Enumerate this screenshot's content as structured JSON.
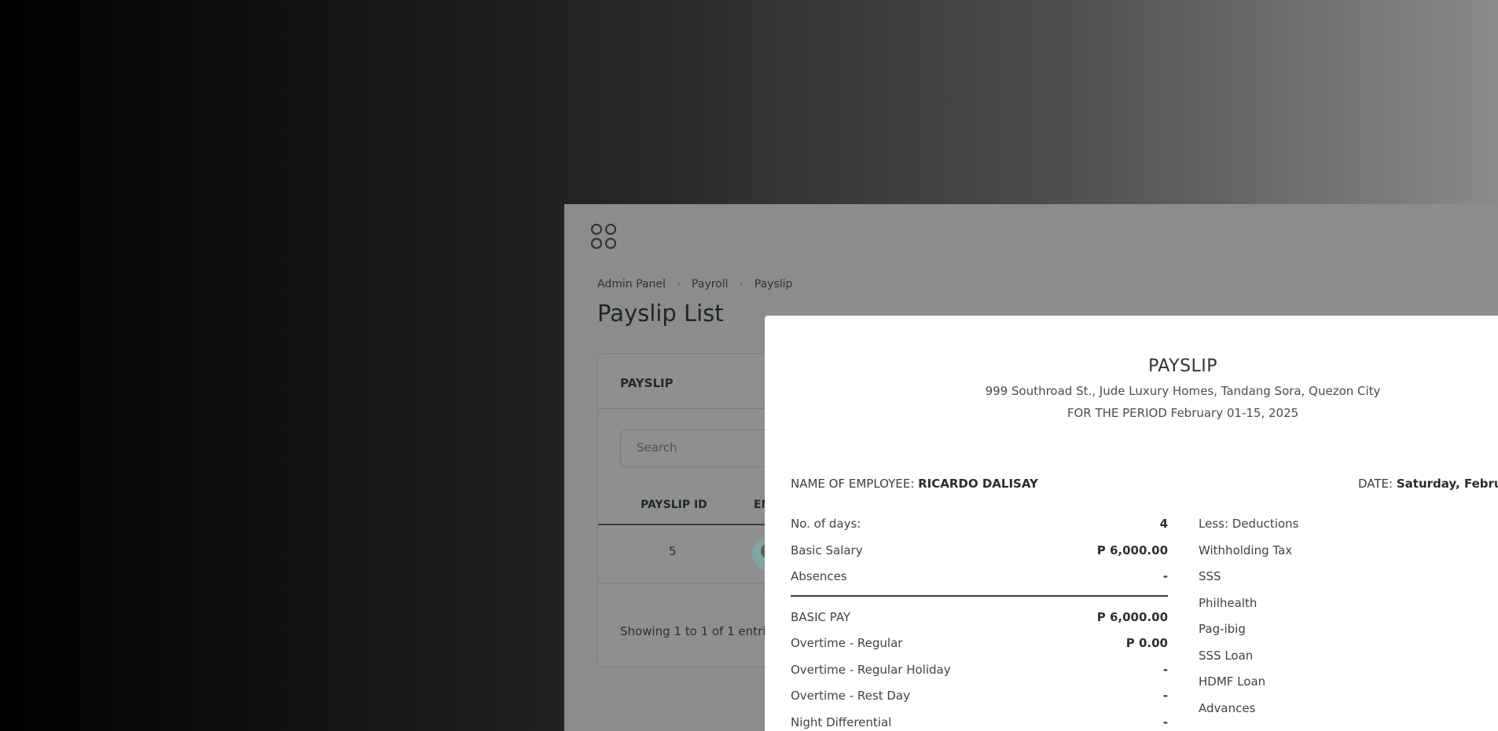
{
  "breadcrumb": [
    "Admin Panel",
    "Payroll",
    "Payslip"
  ],
  "breadcrumb_separator": "›",
  "page_title": "Payslip List",
  "card": {
    "header": "PAYSLIP",
    "search_placeholder": "Search",
    "columns": [
      "PAYSLIP ID",
      "EM"
    ],
    "rows": [
      {
        "id": "5"
      }
    ],
    "showing": "Showing 1 to 1 of 1 entrie"
  },
  "payslip": {
    "title": "PAYSLIP",
    "address": "999 Southroad St., Jude Luxury Homes, Tandang Sora, Quezon City",
    "period": "FOR THE PERIOD February 01-15, 2025",
    "name_label": "NAME OF EMPLOYEE:",
    "name_value": "RICARDO DALISAY",
    "date_label": "DATE:",
    "date_value": "Saturday, Febru",
    "earnings_top": [
      {
        "label": "No. of days:",
        "value": "4"
      },
      {
        "label": "Basic Salary",
        "value": "P 6,000.00"
      },
      {
        "label": "Absences",
        "value": "-"
      }
    ],
    "earnings_bottom": [
      {
        "label": "BASIC PAY",
        "value": "P 6,000.00"
      },
      {
        "label": "Overtime - Regular",
        "value": "P 0.00"
      },
      {
        "label": "Overtime - Regular Holiday",
        "value": "-"
      },
      {
        "label": "Overtime - Rest Day",
        "value": "-"
      },
      {
        "label": "Night Differential",
        "value": "-"
      }
    ],
    "deductions": [
      "Less: Deductions",
      "Withholding Tax",
      "SSS",
      "Philhealth",
      "Pag-ibig",
      "SSS Loan",
      "HDMF Loan",
      "Advances"
    ]
  }
}
